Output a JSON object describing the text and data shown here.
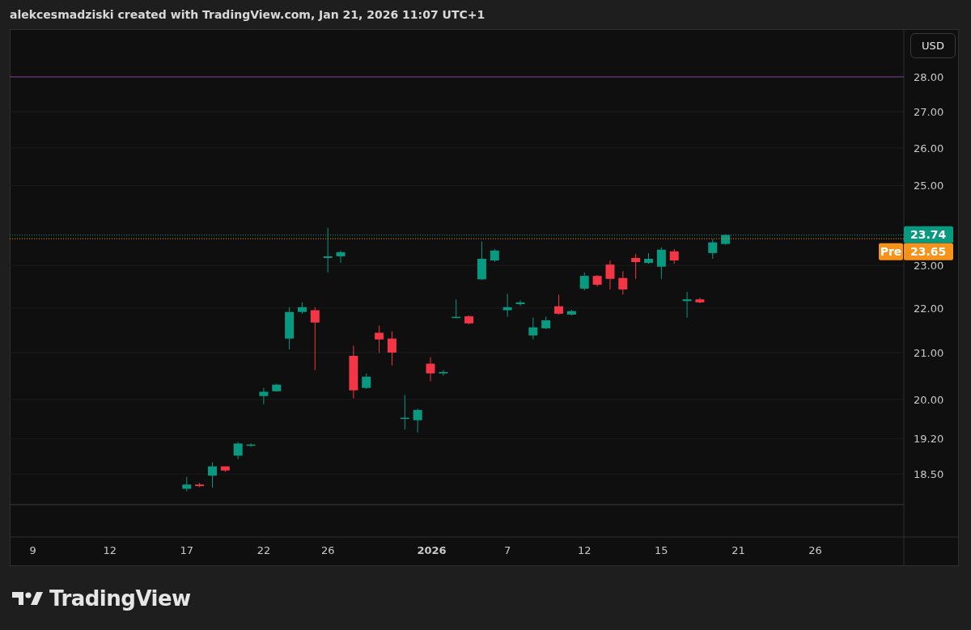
{
  "header": {
    "caption": "alekcesmadziski created with TradingView.com, Jan 21, 2026 11:07 UTC+1"
  },
  "chart": {
    "currency_button": "USD",
    "price_axis": [
      {
        "label": "28.00"
      },
      {
        "label": "27.00"
      },
      {
        "label": "26.00"
      },
      {
        "label": "25.00"
      },
      {
        "label": "23.00"
      },
      {
        "label": "22.00"
      },
      {
        "label": "21.00"
      },
      {
        "label": "20.00"
      },
      {
        "label": "19.20"
      },
      {
        "label": "18.50"
      }
    ],
    "price_tags": [
      {
        "label": "23.74",
        "color": "#089981"
      },
      {
        "tag": "Pre",
        "label": "23.65",
        "color": "#f7931a"
      }
    ],
    "time_axis": [
      {
        "label": "9",
        "kind": "day"
      },
      {
        "label": "12",
        "kind": "day"
      },
      {
        "label": "17",
        "kind": "day"
      },
      {
        "label": "22",
        "kind": "day"
      },
      {
        "label": "26",
        "kind": "day"
      },
      {
        "label": "2026",
        "kind": "year"
      },
      {
        "label": "7",
        "kind": "day"
      },
      {
        "label": "12",
        "kind": "day"
      },
      {
        "label": "15",
        "kind": "day"
      },
      {
        "label": "21",
        "kind": "day"
      },
      {
        "label": "26",
        "kind": "day"
      }
    ]
  },
  "footer": {
    "logo_text": "TradingView"
  }
}
